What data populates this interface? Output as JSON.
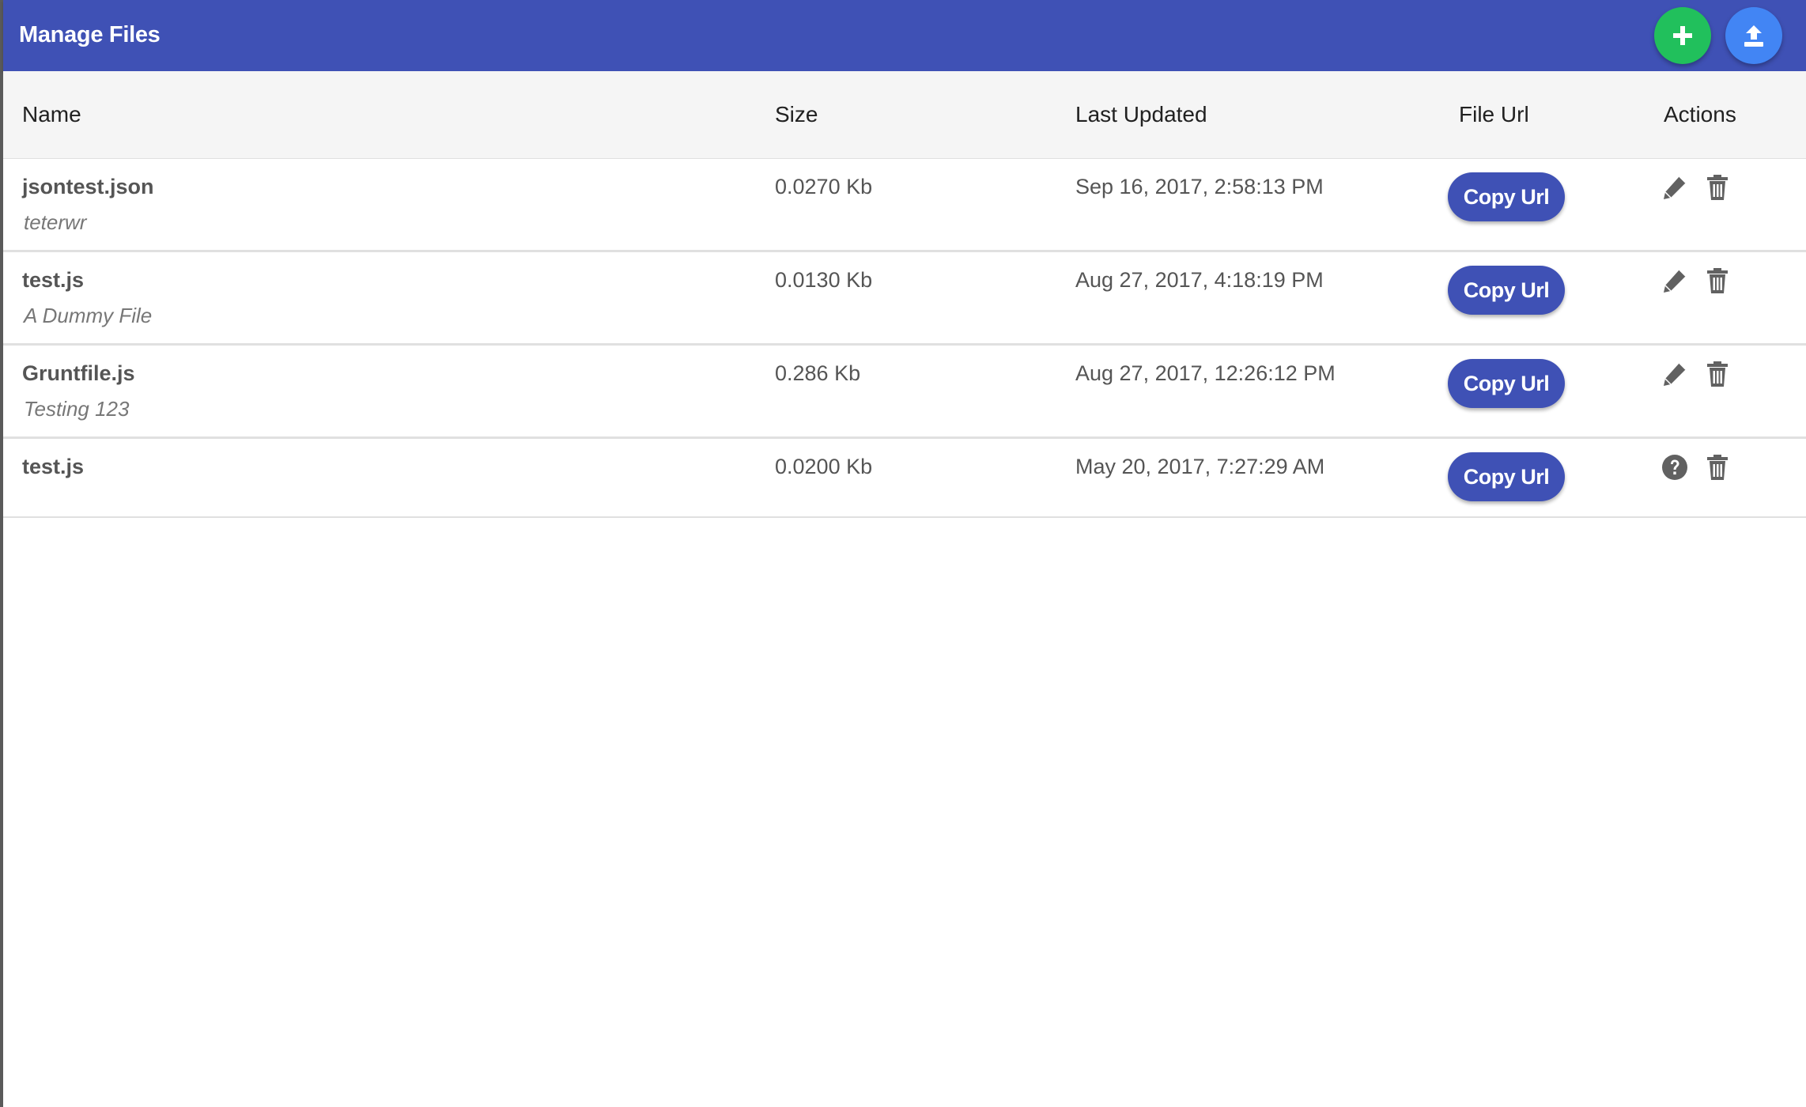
{
  "app_bar": {
    "title": "Manage Files",
    "add_button_icon": "plus-icon",
    "upload_button_icon": "upload-icon",
    "colors": {
      "bar": "#3f51b5",
      "add": "#21c05c",
      "upload": "#4285f4"
    }
  },
  "table": {
    "headers": [
      "Name",
      "Size",
      "Last Updated",
      "File Url",
      "Actions"
    ],
    "rows": [
      {
        "name": "jsontest.json",
        "description": "teterwr",
        "size": "0.0270 Kb",
        "updated": "Sep 16, 2017, 2:58:13 PM",
        "copy_label": "Copy Url",
        "actions": [
          "pencil-icon",
          "trash-icon"
        ]
      },
      {
        "name": "test.js",
        "description": "A Dummy File",
        "size": "0.0130 Kb",
        "updated": "Aug 27, 2017, 4:18:19 PM",
        "copy_label": "Copy Url",
        "actions": [
          "pencil-icon",
          "trash-icon"
        ]
      },
      {
        "name": "Gruntfile.js",
        "description": "Testing 123",
        "size": "0.286 Kb",
        "updated": "Aug 27, 2017, 12:26:12 PM",
        "copy_label": "Copy Url",
        "actions": [
          "pencil-icon",
          "trash-icon"
        ]
      },
      {
        "name": "test.js",
        "description": "",
        "size": "0.0200 Kb",
        "updated": "May 20, 2017, 7:27:29 AM",
        "copy_label": "Copy Url",
        "actions": [
          "help-circle-icon",
          "trash-icon"
        ]
      }
    ]
  }
}
